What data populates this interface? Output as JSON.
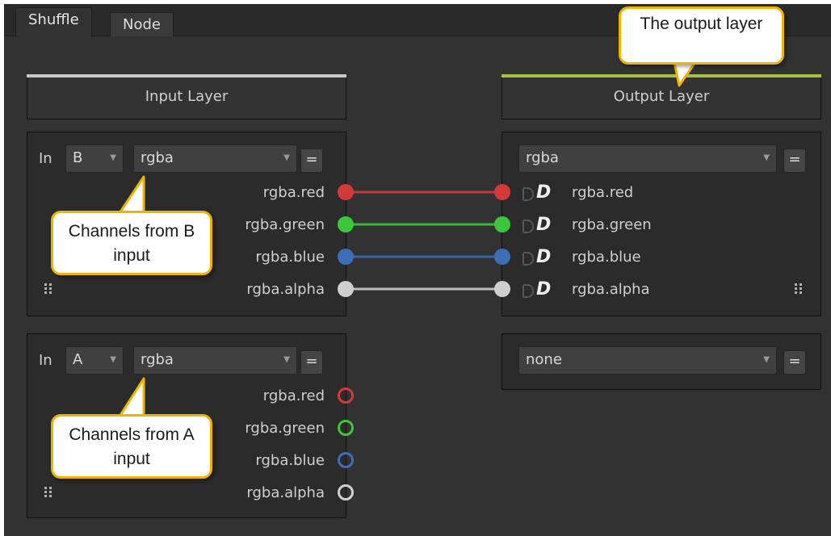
{
  "tabs": [
    {
      "label": "Shuffle",
      "active": true
    },
    {
      "label": "Node",
      "active": false
    }
  ],
  "input_layer": {
    "header": "Input Layer",
    "accent_color": "#c8c8c8",
    "groups": [
      {
        "in_label": "In",
        "input_select": "B",
        "layer_select": "rgba",
        "eq_label": "=",
        "channels": [
          "rgba.red",
          "rgba.green",
          "rgba.blue",
          "rgba.alpha"
        ],
        "connected": true
      },
      {
        "in_label": "In",
        "input_select": "A",
        "layer_select": "rgba",
        "eq_label": "=",
        "channels": [
          "rgba.red",
          "rgba.green",
          "rgba.blue",
          "rgba.alpha"
        ],
        "connected": false
      }
    ]
  },
  "output_layer": {
    "header": "Output Layer",
    "accent_color": "#a6c23c",
    "groups": [
      {
        "layer_select": "rgba",
        "eq_label": "=",
        "channels": [
          "rgba.red",
          "rgba.green",
          "rgba.blue",
          "rgba.alpha"
        ]
      },
      {
        "layer_select": "none",
        "eq_label": "="
      }
    ]
  },
  "channel_colors": {
    "red": "#d23a3a",
    "green": "#3ac83a",
    "blue": "#3d6fb8",
    "alpha": "#cfcfcf"
  },
  "callouts": {
    "output_layer": "The output layer",
    "b_channels": "Channels from B input",
    "a_channels": "Channels from A input"
  },
  "icons": [
    "grip-icon",
    "cutout-icon",
    "d-icon",
    "dropdown-arrow-icon"
  ]
}
